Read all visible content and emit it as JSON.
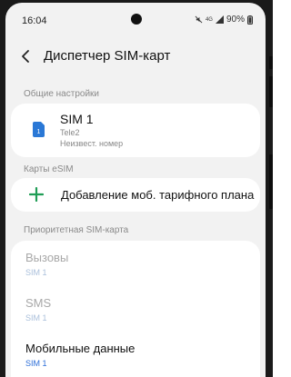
{
  "status_bar": {
    "time": "16:04",
    "battery": "90%",
    "icons": [
      "mute-icon",
      "4g-icon",
      "signal-icon",
      "battery-icon"
    ]
  },
  "header": {
    "title": "Диспетчер SIM-карт"
  },
  "general": {
    "section_label": "Общие настройки",
    "sim": {
      "name": "SIM 1",
      "operator": "Tele2",
      "number": "Неизвест. номер",
      "icon_number": "1"
    }
  },
  "esim": {
    "section_label": "Карты eSIM",
    "add_label": "Добавление моб. тарифного плана"
  },
  "priority": {
    "section_label": "Приоритетная SIM-карта",
    "items": [
      {
        "title": "Вызовы",
        "value": "SIM 1",
        "enabled": false
      },
      {
        "title": "SMS",
        "value": "SIM 1",
        "enabled": false
      },
      {
        "title": "Мобильные данные",
        "value": "SIM 1",
        "enabled": true
      }
    ]
  },
  "colors": {
    "accent": "#2c6ed8",
    "plus": "#1f9d55",
    "sim_icon": "#2a78d6",
    "background": "#f2f2f2"
  }
}
